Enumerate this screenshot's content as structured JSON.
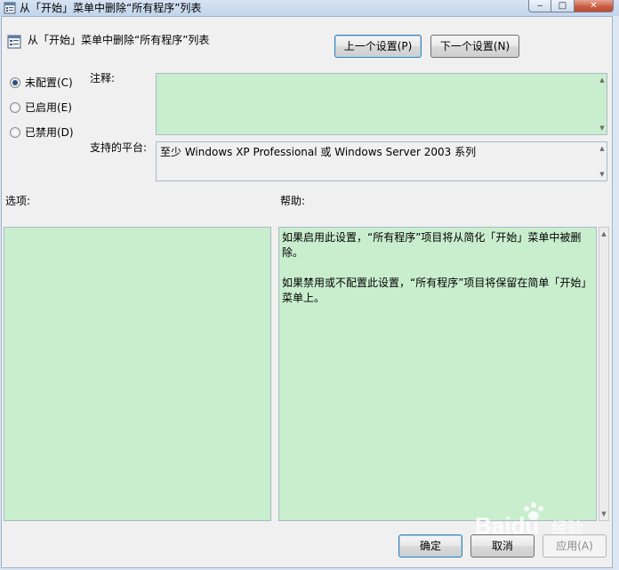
{
  "window": {
    "title": "从「开始」菜单中删除“所有程序”列表",
    "minimize_glyph": "‒",
    "maximize_glyph": "□",
    "close_glyph": "✕"
  },
  "header": {
    "title": "从「开始」菜单中删除“所有程序”列表",
    "prev_button": "上一个设置(P)",
    "next_button": "下一个设置(N)"
  },
  "state": {
    "options": [
      {
        "label": "未配置(C)",
        "checked": true
      },
      {
        "label": "已启用(E)",
        "checked": false
      },
      {
        "label": "已禁用(D)",
        "checked": false
      }
    ]
  },
  "comment": {
    "label": "注释:",
    "value": ""
  },
  "platform": {
    "label": "支持的平台:",
    "value": "至少 Windows XP Professional 或 Windows Server 2003 系列"
  },
  "options_panel": {
    "label": "选项:"
  },
  "help_panel": {
    "label": "帮助:",
    "paragraphs": [
      "如果启用此设置，“所有程序”项目将从简化「开始」菜单中被删除。",
      "如果禁用或不配置此设置，“所有程序”项目将保留在简单「开始」菜单上。"
    ]
  },
  "footer": {
    "ok": "确定",
    "cancel": "取消",
    "apply": "应用(A)"
  },
  "watermark": {
    "text": "经验",
    "brand": "Baidu"
  },
  "colors": {
    "panel_green": "#c9eece",
    "window_bg": "#f0f0f0",
    "radio_dot": "#2b4f82"
  },
  "icons": {
    "title": "policy-setting-icon",
    "header": "policy-setting-icon"
  }
}
